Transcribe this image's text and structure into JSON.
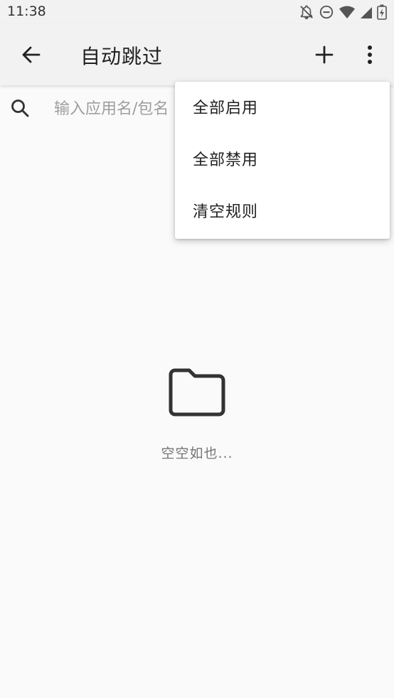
{
  "status_bar": {
    "time": "11:38",
    "icons": [
      "notifications-off-icon",
      "do-not-disturb-icon",
      "wifi-icon",
      "signal-icon",
      "battery-charging-icon"
    ]
  },
  "app_bar": {
    "title": "自动跳过",
    "actions": [
      "back-arrow-icon",
      "add-icon",
      "more-vert-icon"
    ]
  },
  "search": {
    "placeholder": "输入应用名/包名",
    "value": ""
  },
  "empty_state": {
    "icon": "folder-icon",
    "text": "空空如也..."
  },
  "overflow_menu": {
    "items": [
      {
        "label": "全部启用"
      },
      {
        "label": "全部禁用"
      },
      {
        "label": "清空规则"
      }
    ]
  },
  "colors": {
    "background": "#fafafa",
    "app_bar": "#f2f2f2",
    "menu_bg": "#ffffff",
    "icon": "#333333",
    "secondary_text": "#757575"
  }
}
